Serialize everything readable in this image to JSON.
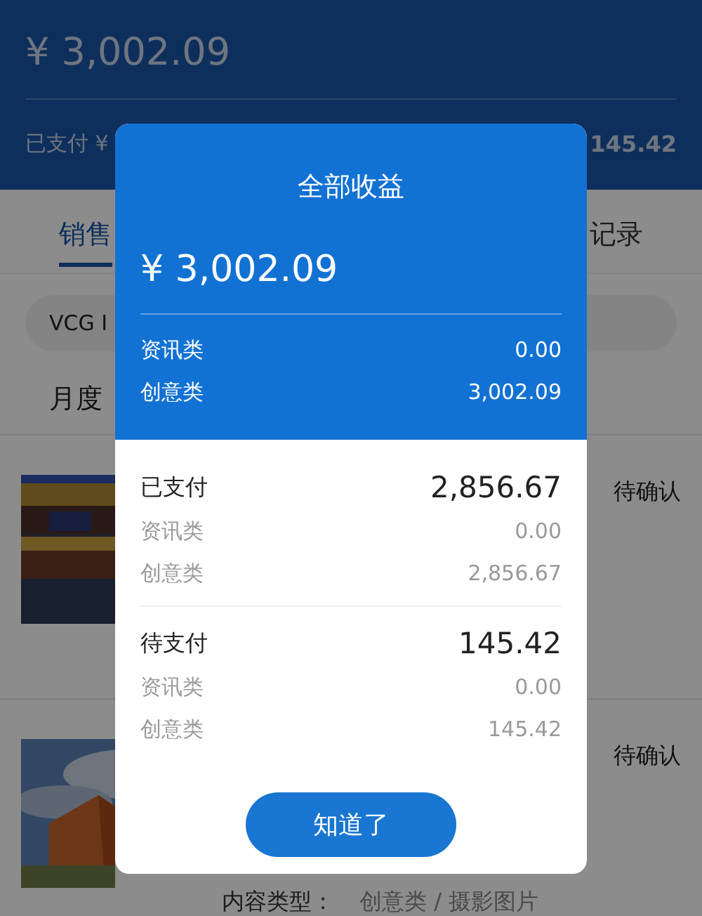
{
  "header": {
    "total": "¥ 3,002.09",
    "paid_label": "已支付 ¥",
    "pending_amount": "145.42"
  },
  "tabs": [
    {
      "label": "销售",
      "selected": true
    },
    {
      "label": "记录",
      "selected": false
    }
  ],
  "filter": {
    "value": "VCG I"
  },
  "period": "月度",
  "items": [
    {
      "kind": "picture",
      "status": "待确认"
    },
    {
      "kind": "picture",
      "status": "待确认",
      "content_type_label": "内容类型：",
      "content_type": "创意类 / 摄影图片"
    }
  ],
  "dialog": {
    "title": "全部收益",
    "total": "¥ 3,002.09",
    "breakdown": [
      {
        "label": "资讯类",
        "value": "0.00"
      },
      {
        "label": "创意类",
        "value": "3,002.09"
      }
    ],
    "groups": [
      {
        "label": "已支付",
        "amount": "2,856.67",
        "rows": [
          {
            "label": "资讯类",
            "value": "0.00"
          },
          {
            "label": "创意类",
            "value": "2,856.67"
          }
        ]
      },
      {
        "label": "待支付",
        "amount": "145.42",
        "rows": [
          {
            "label": "资讯类",
            "value": "0.00"
          },
          {
            "label": "创意类",
            "value": "145.42"
          }
        ]
      }
    ],
    "button": "知道了"
  }
}
